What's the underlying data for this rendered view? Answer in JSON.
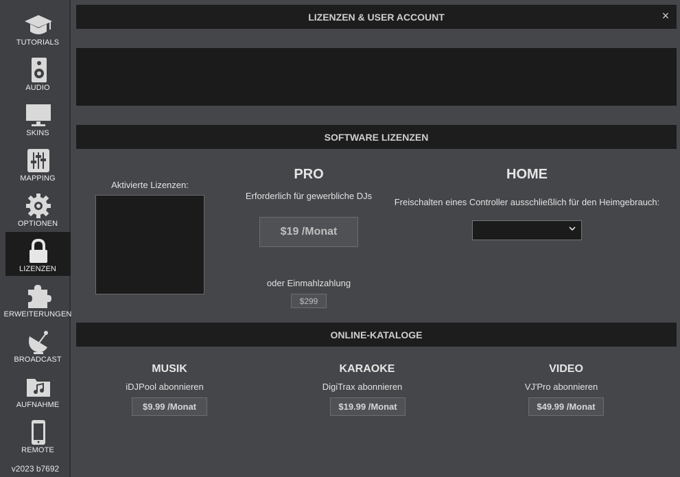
{
  "sidebar": {
    "items": [
      {
        "label": "TUTORIALS",
        "icon": "graduation-cap-icon"
      },
      {
        "label": "AUDIO",
        "icon": "speaker-icon"
      },
      {
        "label": "SKINS",
        "icon": "monitor-icon"
      },
      {
        "label": "MAPPING",
        "icon": "sliders-icon"
      },
      {
        "label": "OPTIONEN",
        "icon": "gear-icon"
      },
      {
        "label": "LIZENZEN",
        "icon": "lock-icon"
      },
      {
        "label": "ERWEITERUNGEN",
        "icon": "puzzle-icon"
      },
      {
        "label": "BROADCAST",
        "icon": "satellite-dish-icon"
      },
      {
        "label": "AUFNAHME",
        "icon": "music-folder-icon"
      },
      {
        "label": "REMOTE",
        "icon": "phone-icon"
      }
    ],
    "active": "LIZENZEN",
    "version": "v2023 b7692"
  },
  "header": {
    "title": "LIZENZEN & USER ACCOUNT",
    "close": "×"
  },
  "software": {
    "title": "SOFTWARE LIZENZEN",
    "activated_label": "Aktivierte Lizenzen:",
    "pro": {
      "title": "PRO",
      "description": "Erforderlich für gewerbliche DJs",
      "price_button": "$19 /Monat",
      "one_time_label": "oder Einmahlzahlung",
      "one_time_price": "$299"
    },
    "home": {
      "title": "HOME",
      "description": "Freischalten eines Controller ausschließlich für den Heimgebrauch:",
      "select_value": ""
    }
  },
  "catalogs": {
    "title": "ONLINE-KATALOGE",
    "items": [
      {
        "title": "MUSIK",
        "subtitle": "iDJPool abonnieren",
        "price": "$9.99 /Monat"
      },
      {
        "title": "KARAOKE",
        "subtitle": "DigiTrax abonnieren",
        "price": "$19.99 /Monat"
      },
      {
        "title": "VIDEO",
        "subtitle": "VJ'Pro abonnieren",
        "price": "$49.99 /Monat"
      }
    ]
  },
  "colors": {
    "panel": "#1d1d1e",
    "background": "#454649",
    "sidebar": "#3f4043"
  }
}
